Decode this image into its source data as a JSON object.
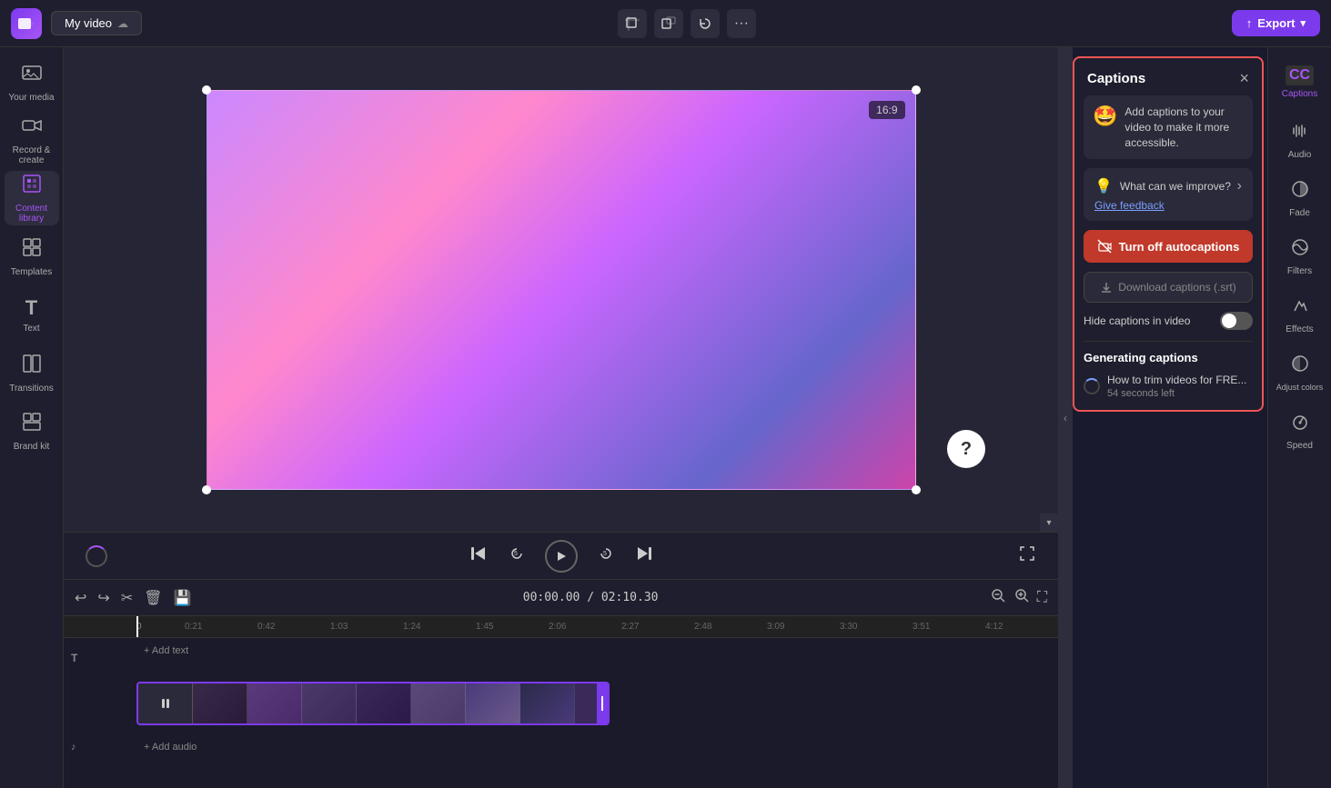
{
  "app": {
    "logo_icon": "🎬",
    "video_title": "My video",
    "cloud_icon": "☁️"
  },
  "topbar": {
    "crop_icon": "⬜",
    "resize_icon": "⬛",
    "rotate_icon": "↻",
    "more_icon": "···",
    "export_label": "Export",
    "export_icon": "↑"
  },
  "sidebar": {
    "items": [
      {
        "id": "your-media",
        "icon": "🖼",
        "label": "Your media"
      },
      {
        "id": "record",
        "icon": "🎥",
        "label": "Record & create"
      },
      {
        "id": "content-library",
        "icon": "🏛",
        "label": "Content library"
      },
      {
        "id": "templates",
        "icon": "⊞",
        "label": "Templates"
      },
      {
        "id": "text",
        "icon": "T",
        "label": "Text"
      },
      {
        "id": "transitions",
        "icon": "⊡",
        "label": "Transitions"
      },
      {
        "id": "brand",
        "icon": "◈",
        "label": "Brand kit"
      }
    ]
  },
  "canvas": {
    "ratio": "16:9"
  },
  "playback": {
    "skip_back_icon": "⏮",
    "rewind_icon": "↺",
    "play_icon": "▶",
    "forward_icon": "↻",
    "skip_forward_icon": "⏭"
  },
  "timeline": {
    "undo_icon": "↩",
    "redo_icon": "↪",
    "cut_icon": "✂",
    "delete_icon": "🗑",
    "save_icon": "💾",
    "current_time": "00:00.00",
    "total_time": "02:10.30",
    "zoom_out_icon": "−",
    "zoom_in_icon": "+",
    "fullscreen_icon": "⛶",
    "ruler_marks": [
      "0:21",
      "0:42",
      "1:03",
      "1:24",
      "1:45",
      "2:06",
      "2:27",
      "2:48",
      "3:09",
      "3:30",
      "3:51",
      "4:12"
    ],
    "add_text_label": "+ Add text",
    "add_audio_label": "+ Add audio"
  },
  "captions_panel": {
    "title": "Captions",
    "close_icon": "×",
    "tip": {
      "emoji": "🤩",
      "text": "Add captions to your video to make it more accessible."
    },
    "feedback": {
      "icon": "💡",
      "label": "What can we improve?",
      "chevron": "›",
      "link_text": "Give feedback"
    },
    "turn_off_label": "Turn off autocaptions",
    "turn_off_icon": "⊗",
    "download_label": "Download captions (.srt)",
    "download_icon": "↓",
    "hide_label": "Hide captions in video",
    "generating_title": "Generating captions",
    "generating_item": {
      "text": "How to trim videos for FRE...",
      "sub_text": "54 seconds left"
    }
  },
  "right_sidebar": {
    "items": [
      {
        "id": "captions",
        "icon": "CC",
        "label": "Captions",
        "active": true
      },
      {
        "id": "audio",
        "icon": "🔊",
        "label": "Audio"
      },
      {
        "id": "fade",
        "icon": "◑",
        "label": "Fade"
      },
      {
        "id": "filters",
        "icon": "⚙",
        "label": "Filters"
      },
      {
        "id": "effects",
        "icon": "✏",
        "label": "Effects"
      },
      {
        "id": "adjust",
        "icon": "◐",
        "label": "Adjust colors"
      },
      {
        "id": "speed",
        "icon": "⏩",
        "label": "Speed"
      }
    ]
  }
}
